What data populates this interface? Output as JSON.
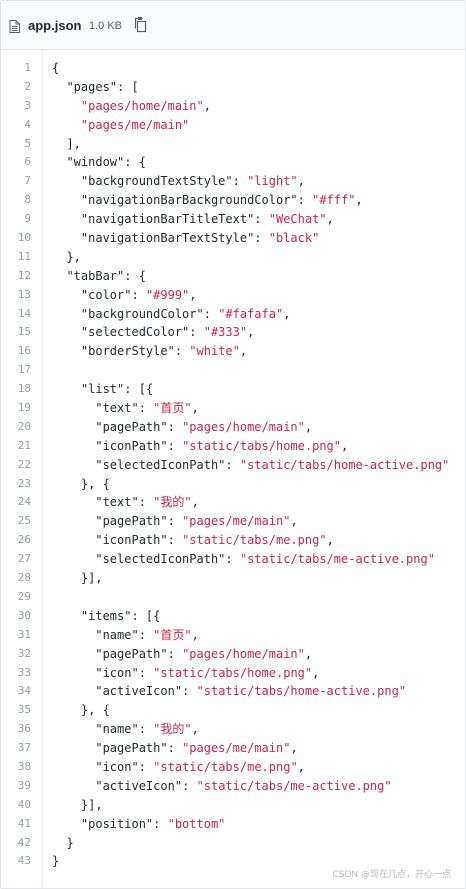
{
  "header": {
    "file_name": "app.json",
    "file_size": "1.0 KB",
    "file_icon": "file-icon",
    "copy_icon": "copy-icon"
  },
  "code_lines": [
    "{",
    "  \"pages\": [",
    "    \"pages/home/main\",",
    "    \"pages/me/main\"",
    "  ],",
    "  \"window\": {",
    "    \"backgroundTextStyle\": \"light\",",
    "    \"navigationBarBackgroundColor\": \"#fff\",",
    "    \"navigationBarTitleText\": \"WeChat\",",
    "    \"navigationBarTextStyle\": \"black\"",
    "  },",
    "  \"tabBar\": {",
    "    \"color\": \"#999\",",
    "    \"backgroundColor\": \"#fafafa\",",
    "    \"selectedColor\": \"#333\",",
    "    \"borderStyle\": \"white\",",
    "",
    "    \"list\": [{",
    "      \"text\": \"首页\",",
    "      \"pagePath\": \"pages/home/main\",",
    "      \"iconPath\": \"static/tabs/home.png\",",
    "      \"selectedIconPath\": \"static/tabs/home-active.png\"",
    "    }, {",
    "      \"text\": \"我的\",",
    "      \"pagePath\": \"pages/me/main\",",
    "      \"iconPath\": \"static/tabs/me.png\",",
    "      \"selectedIconPath\": \"static/tabs/me-active.png\"",
    "    }],",
    "",
    "    \"items\": [{",
    "      \"name\": \"首页\",",
    "      \"pagePath\": \"pages/home/main\",",
    "      \"icon\": \"static/tabs/home.png\",",
    "      \"activeIcon\": \"static/tabs/home-active.png\"",
    "    }, {",
    "      \"name\": \"我的\",",
    "      \"pagePath\": \"pages/me/main\",",
    "      \"icon\": \"static/tabs/me.png\",",
    "      \"activeIcon\": \"static/tabs/me-active.png\"",
    "    }],",
    "    \"position\": \"bottom\"",
    "  }",
    "}"
  ],
  "watermark": "CSDN @现在几点，开心一点",
  "colors": {
    "string": "#c7254e",
    "text": "#24292e",
    "line_number": "#959da5"
  }
}
